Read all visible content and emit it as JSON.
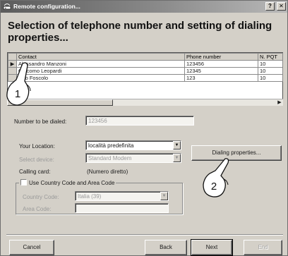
{
  "window": {
    "title": "Remote configuration...",
    "help_label": "?",
    "close_label": "✕"
  },
  "heading": "Selection of telephone number and setting of dialing properties...",
  "contacts": {
    "columns": [
      "",
      "Contact",
      "Phone number",
      "N. PQT"
    ],
    "rows": [
      {
        "contact": "Alessandro Manzoni",
        "phone": "123456",
        "npqt": "10",
        "selected": true
      },
      {
        "contact": "Giacomo Leopardi",
        "phone": "12345",
        "npqt": "10",
        "selected": false
      },
      {
        "contact": "Ugo Foscolo",
        "phone": "123",
        "npqt": "10",
        "selected": false
      }
    ],
    "current_row_marker": "▶"
  },
  "number_to_dial": {
    "label": "Number to be dialed:",
    "value": "123456"
  },
  "location": {
    "label": "Your Location:",
    "value": "località predefinita"
  },
  "device": {
    "label": "Select device:",
    "value": "Standard Modem"
  },
  "calling_card": {
    "label": "Calling card:",
    "value": "(Numero diretto)"
  },
  "dialing_properties_button": "Dialing properties...",
  "country_area": {
    "checkbox_label": "Use Country Code and Area Code",
    "checked": false,
    "country_label": "Country Code:",
    "country_value": "Italia (39)",
    "area_label": "Area Code:",
    "area_value": ""
  },
  "buttons": {
    "cancel": "Cancel",
    "back": "Back",
    "next": "Next",
    "end": "End"
  },
  "callouts": [
    "1",
    "2"
  ],
  "icons": {
    "title": "modem-icon",
    "dropdown": "chevron-down-icon",
    "callout": "hand-pointer-icon"
  },
  "colors": {
    "title_bar": "#5c5c5c",
    "dialog": "#d4d0c8"
  }
}
